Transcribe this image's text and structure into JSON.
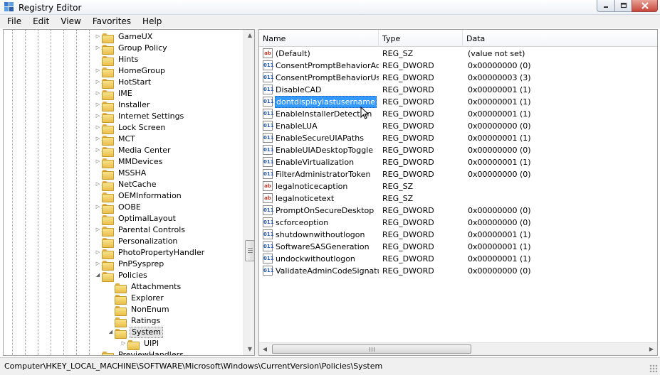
{
  "window": {
    "title": "Registry Editor"
  },
  "menu": [
    "File",
    "Edit",
    "View",
    "Favorites",
    "Help"
  ],
  "tree": {
    "items": [
      {
        "label": "GameUX",
        "depth": 0,
        "expander": "collapsed"
      },
      {
        "label": "Group Policy",
        "depth": 0,
        "expander": "collapsed"
      },
      {
        "label": "Hints",
        "depth": 0,
        "expander": "none"
      },
      {
        "label": "HomeGroup",
        "depth": 0,
        "expander": "collapsed"
      },
      {
        "label": "HotStart",
        "depth": 0,
        "expander": "collapsed"
      },
      {
        "label": "IME",
        "depth": 0,
        "expander": "collapsed"
      },
      {
        "label": "Installer",
        "depth": 0,
        "expander": "collapsed"
      },
      {
        "label": "Internet Settings",
        "depth": 0,
        "expander": "collapsed"
      },
      {
        "label": "Lock Screen",
        "depth": 0,
        "expander": "collapsed"
      },
      {
        "label": "MCT",
        "depth": 0,
        "expander": "collapsed"
      },
      {
        "label": "Media Center",
        "depth": 0,
        "expander": "collapsed"
      },
      {
        "label": "MMDevices",
        "depth": 0,
        "expander": "collapsed"
      },
      {
        "label": "MSSHA",
        "depth": 0,
        "expander": "none"
      },
      {
        "label": "NetCache",
        "depth": 0,
        "expander": "collapsed"
      },
      {
        "label": "OEMInformation",
        "depth": 0,
        "expander": "none"
      },
      {
        "label": "OOBE",
        "depth": 0,
        "expander": "collapsed"
      },
      {
        "label": "OptimalLayout",
        "depth": 0,
        "expander": "none"
      },
      {
        "label": "Parental Controls",
        "depth": 0,
        "expander": "collapsed"
      },
      {
        "label": "Personalization",
        "depth": 0,
        "expander": "none"
      },
      {
        "label": "PhotoPropertyHandler",
        "depth": 0,
        "expander": "collapsed"
      },
      {
        "label": "PnPSysprep",
        "depth": 0,
        "expander": "collapsed"
      },
      {
        "label": "Policies",
        "depth": 0,
        "expander": "expanded"
      },
      {
        "label": "Attachments",
        "depth": 1,
        "expander": "none"
      },
      {
        "label": "Explorer",
        "depth": 1,
        "expander": "none"
      },
      {
        "label": "NonEnum",
        "depth": 1,
        "expander": "none"
      },
      {
        "label": "Ratings",
        "depth": 1,
        "expander": "none"
      },
      {
        "label": "System",
        "depth": 1,
        "expander": "expanded",
        "selected": true
      },
      {
        "label": "UIPI",
        "depth": 2,
        "expander": "collapsed"
      },
      {
        "label": "PreviewHandlers",
        "depth": 0,
        "expander": "none"
      }
    ]
  },
  "list": {
    "columns": [
      "Name",
      "Type",
      "Data"
    ],
    "rows": [
      {
        "icon": "string-value-icon",
        "name": "(Default)",
        "type": "REG_SZ",
        "data": "(value not set)"
      },
      {
        "icon": "dword-value-icon",
        "name": "ConsentPromptBehaviorAdmin",
        "type": "REG_DWORD",
        "data": "0x00000000 (0)"
      },
      {
        "icon": "dword-value-icon",
        "name": "ConsentPromptBehaviorUser",
        "type": "REG_DWORD",
        "data": "0x00000003 (3)"
      },
      {
        "icon": "dword-value-icon",
        "name": "DisableCAD",
        "type": "REG_DWORD",
        "data": "0x00000001 (1)"
      },
      {
        "icon": "dword-value-icon",
        "name": "dontdisplaylastusername",
        "type": "REG_DWORD",
        "data": "0x00000001 (1)",
        "selected": true
      },
      {
        "icon": "dword-value-icon",
        "name": "EnableInstallerDetection",
        "type": "REG_DWORD",
        "data": "0x00000001 (1)"
      },
      {
        "icon": "dword-value-icon",
        "name": "EnableLUA",
        "type": "REG_DWORD",
        "data": "0x00000000 (0)"
      },
      {
        "icon": "dword-value-icon",
        "name": "EnableSecureUIAPaths",
        "type": "REG_DWORD",
        "data": "0x00000001 (1)"
      },
      {
        "icon": "dword-value-icon",
        "name": "EnableUIADesktopToggle",
        "type": "REG_DWORD",
        "data": "0x00000000 (0)"
      },
      {
        "icon": "dword-value-icon",
        "name": "EnableVirtualization",
        "type": "REG_DWORD",
        "data": "0x00000001 (1)"
      },
      {
        "icon": "dword-value-icon",
        "name": "FilterAdministratorToken",
        "type": "REG_DWORD",
        "data": "0x00000000 (0)"
      },
      {
        "icon": "string-value-icon",
        "name": "legalnoticecaption",
        "type": "REG_SZ",
        "data": ""
      },
      {
        "icon": "string-value-icon",
        "name": "legalnoticetext",
        "type": "REG_SZ",
        "data": ""
      },
      {
        "icon": "dword-value-icon",
        "name": "PromptOnSecureDesktop",
        "type": "REG_DWORD",
        "data": "0x00000000 (0)"
      },
      {
        "icon": "dword-value-icon",
        "name": "scforceoption",
        "type": "REG_DWORD",
        "data": "0x00000000 (0)"
      },
      {
        "icon": "dword-value-icon",
        "name": "shutdownwithoutlogon",
        "type": "REG_DWORD",
        "data": "0x00000001 (1)"
      },
      {
        "icon": "dword-value-icon",
        "name": "SoftwareSASGeneration",
        "type": "REG_DWORD",
        "data": "0x00000001 (1)"
      },
      {
        "icon": "dword-value-icon",
        "name": "undockwithoutlogon",
        "type": "REG_DWORD",
        "data": "0x00000001 (1)"
      },
      {
        "icon": "dword-value-icon",
        "name": "ValidateAdminCodeSignatures",
        "type": "REG_DWORD",
        "data": "0x00000000 (0)"
      }
    ]
  },
  "status": {
    "path": "Computer\\HKEY_LOCAL_MACHINE\\SOFTWARE\\Microsoft\\Windows\\CurrentVersion\\Policies\\System"
  },
  "icons": {
    "string_glyph": "ab",
    "dword_glyph": "011"
  },
  "colors": {
    "selection": "#3399ff",
    "close_button": "#c8453a",
    "folder": "#e8bf4a"
  }
}
